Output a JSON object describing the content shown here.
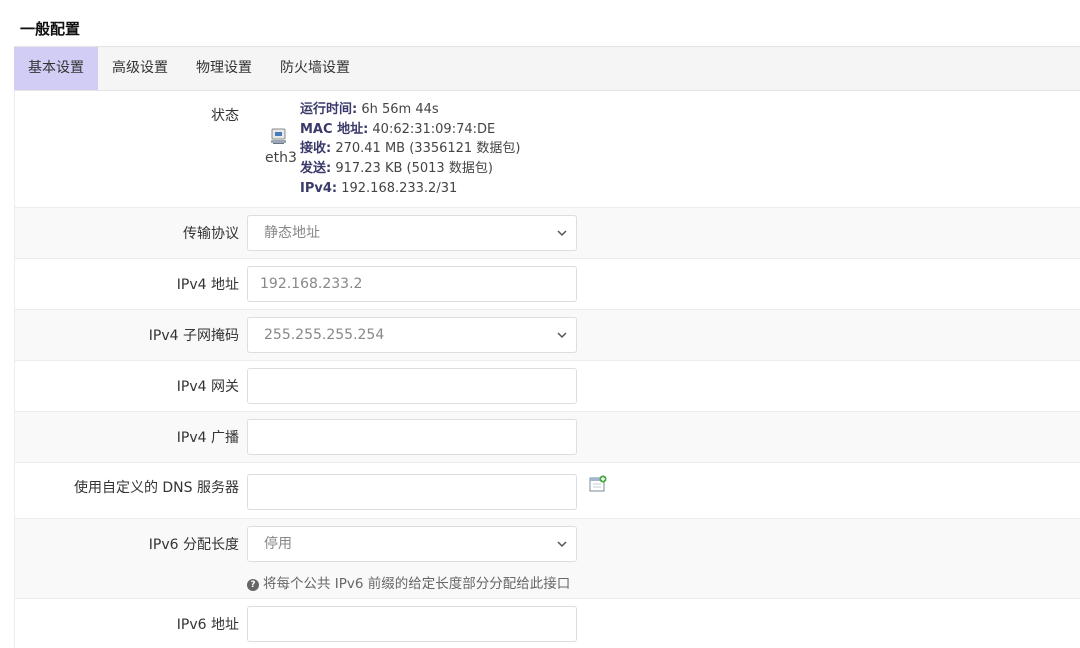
{
  "section": {
    "title": "一般配置"
  },
  "tabs": [
    {
      "label": "基本设置",
      "active": true
    },
    {
      "label": "高级设置",
      "active": false
    },
    {
      "label": "物理设置",
      "active": false
    },
    {
      "label": "防火墙设置",
      "active": false
    }
  ],
  "status": {
    "label": "状态",
    "interface": "eth3",
    "uptime_key": "运行时间:",
    "uptime_val": " 6h 56m 44s",
    "mac_key": "MAC 地址:",
    "mac_val": " 40:62:31:09:74:DE",
    "rx_key": "接收:",
    "rx_val": " 270.41 MB (3356121 数据包)",
    "tx_key": "发送:",
    "tx_val": " 917.23 KB (5013 数据包)",
    "ipv4_key": "IPv4:",
    "ipv4_val": " 192.168.233.2/31"
  },
  "fields": {
    "protocol": {
      "label": "传输协议",
      "value": "静态地址"
    },
    "ipv4_addr": {
      "label": "IPv4 地址",
      "value": "192.168.233.2"
    },
    "ipv4_mask": {
      "label": "IPv4 子网掩码",
      "value": "255.255.255.254"
    },
    "ipv4_gw": {
      "label": "IPv4 网关",
      "value": ""
    },
    "ipv4_bcast": {
      "label": "IPv4 广播",
      "value": ""
    },
    "dns": {
      "label": "使用自定义的 DNS 服务器",
      "value": ""
    },
    "ipv6_len": {
      "label": "IPv6 分配长度",
      "value": "停用",
      "help": "将每个公共 IPv6 前缀的给定长度部分分配给此接口"
    },
    "ipv6_addr": {
      "label": "IPv6 地址",
      "value": ""
    }
  },
  "colors": {
    "active_tab": "#d2cdf5",
    "accent_text": "#3a3a6a"
  },
  "icons": {
    "interface": "ethernet-port-icon",
    "add": "add-entry-icon",
    "help": "question-circle-icon",
    "dropdown": "chevron-down-icon"
  }
}
